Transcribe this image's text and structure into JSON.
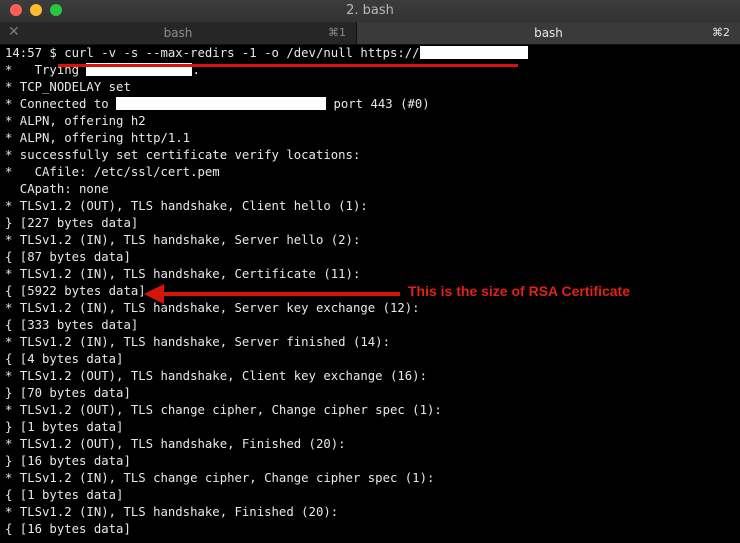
{
  "window": {
    "title": "2. bash",
    "colors": {
      "close": "#ff5f57",
      "minimize": "#febc2e",
      "maximize": "#28c840"
    }
  },
  "tabs": [
    {
      "label": "bash",
      "shortcut": "⌘1",
      "close": "✕"
    },
    {
      "label": "bash",
      "shortcut": "⌘2",
      "close": "✕"
    }
  ],
  "terminal": {
    "command_prefix": "14:57 $ curl -v -s --max-redirs -1 -o /dev/null https://",
    "trying_prefix": "*   Trying ",
    "trying_suffix": ".",
    "connected_prefix": "* Connected to ",
    "connected_suffix": " port 443 (#0)",
    "lines": [
      "* TCP_NODELAY set",
      "* ALPN, offering h2",
      "* ALPN, offering http/1.1",
      "* successfully set certificate verify locations:",
      "*   CAfile: /etc/ssl/cert.pem",
      "  CApath: none",
      "* TLSv1.2 (OUT), TLS handshake, Client hello (1):",
      "} [227 bytes data]",
      "* TLSv1.2 (IN), TLS handshake, Server hello (2):",
      "{ [87 bytes data]",
      "* TLSv1.2 (IN), TLS handshake, Certificate (11):",
      "{ [5922 bytes data]",
      "* TLSv1.2 (IN), TLS handshake, Server key exchange (12):",
      "{ [333 bytes data]",
      "* TLSv1.2 (IN), TLS handshake, Server finished (14):",
      "{ [4 bytes data]",
      "* TLSv1.2 (OUT), TLS handshake, Client key exchange (16):",
      "} [70 bytes data]",
      "* TLSv1.2 (OUT), TLS change cipher, Change cipher spec (1):",
      "} [1 bytes data]",
      "* TLSv1.2 (OUT), TLS handshake, Finished (20):",
      "} [16 bytes data]",
      "* TLSv1.2 (IN), TLS change cipher, Change cipher spec (1):",
      "{ [1 bytes data]",
      "* TLSv1.2 (IN), TLS handshake, Finished (20):",
      "{ [16 bytes data]"
    ]
  },
  "annotation": {
    "text": "This is the size of RSA Certificate",
    "color": "#d5150a"
  }
}
